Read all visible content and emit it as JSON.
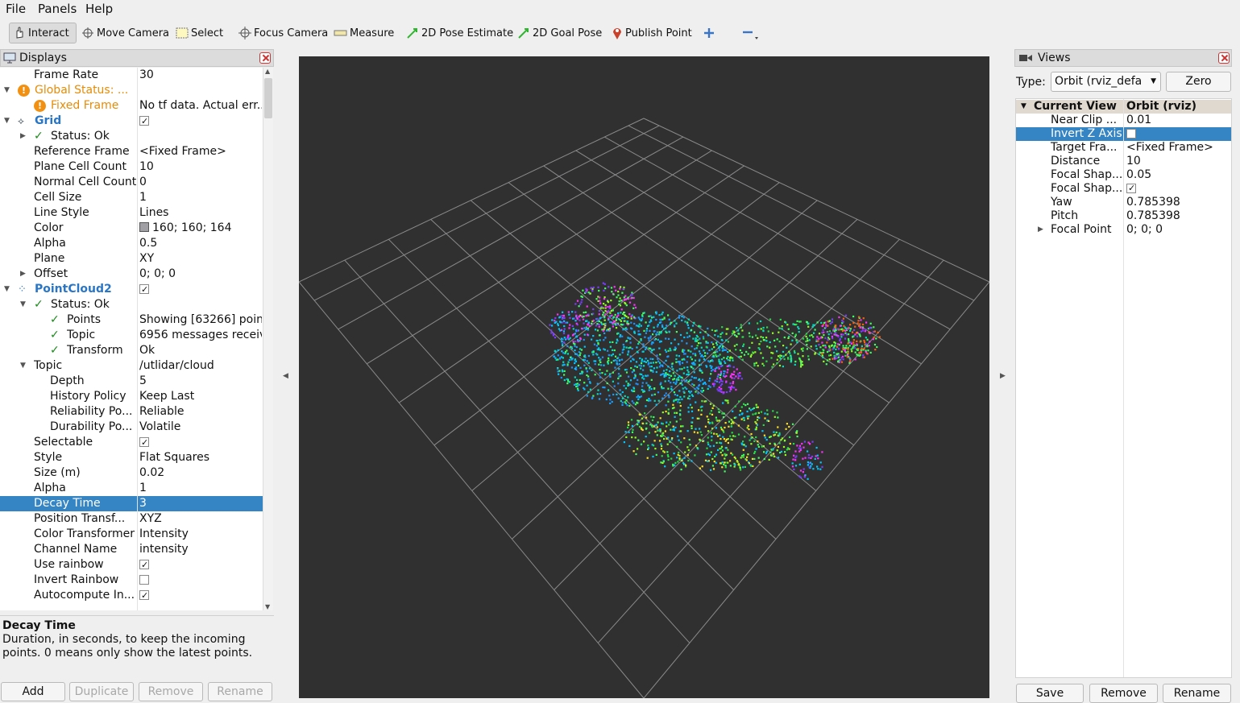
{
  "menu": {
    "file": "File",
    "panels": "Panels",
    "help": "Help"
  },
  "toolbar": {
    "interact": "Interact",
    "move_camera": "Move Camera",
    "select": "Select",
    "focus_camera": "Focus Camera",
    "measure": "Measure",
    "pose_estimate": "2D Pose Estimate",
    "goal_pose": "2D Goal Pose",
    "publish_point": "Publish Point"
  },
  "displays": {
    "title": "Displays",
    "rows": [
      {
        "name": "Frame Rate",
        "value": "30"
      },
      {
        "name": "Global Status: ...",
        "value": ""
      },
      {
        "name": "Fixed Frame",
        "value": "No tf data.  Actual err..."
      },
      {
        "name": "Grid",
        "value": ""
      },
      {
        "name": "Status: Ok",
        "value": ""
      },
      {
        "name": "Reference Frame",
        "value": "<Fixed Frame>"
      },
      {
        "name": "Plane Cell Count",
        "value": "10"
      },
      {
        "name": "Normal Cell Count",
        "value": "0"
      },
      {
        "name": "Cell Size",
        "value": "1"
      },
      {
        "name": "Line Style",
        "value": "Lines"
      },
      {
        "name": "Color",
        "value": "160; 160; 164"
      },
      {
        "name": "Alpha",
        "value": "0.5"
      },
      {
        "name": "Plane",
        "value": "XY"
      },
      {
        "name": "Offset",
        "value": "0; 0; 0"
      },
      {
        "name": "PointCloud2",
        "value": ""
      },
      {
        "name": "Status: Ok",
        "value": ""
      },
      {
        "name": "Points",
        "value": "Showing [63266] poin..."
      },
      {
        "name": "Topic",
        "value": "6956 messages receiv..."
      },
      {
        "name": "Transform",
        "value": "Ok"
      },
      {
        "name": "Topic",
        "value": "/utlidar/cloud"
      },
      {
        "name": "Depth",
        "value": "5"
      },
      {
        "name": "History Policy",
        "value": "Keep Last"
      },
      {
        "name": "Reliability Po...",
        "value": "Reliable"
      },
      {
        "name": "Durability Po...",
        "value": "Volatile"
      },
      {
        "name": "Selectable",
        "value": ""
      },
      {
        "name": "Style",
        "value": "Flat Squares"
      },
      {
        "name": "Size (m)",
        "value": "0.02"
      },
      {
        "name": "Alpha",
        "value": "1"
      },
      {
        "name": "Decay Time",
        "value": "3"
      },
      {
        "name": "Position Transf...",
        "value": "XYZ"
      },
      {
        "name": "Color Transformer",
        "value": "Intensity"
      },
      {
        "name": "Channel Name",
        "value": "intensity"
      },
      {
        "name": "Use rainbow",
        "value": ""
      },
      {
        "name": "Invert Rainbow",
        "value": ""
      },
      {
        "name": "Autocompute In...",
        "value": ""
      }
    ],
    "grid_color": "#a0a0a4",
    "desc_title": "Decay Time",
    "desc_body": "Duration, in seconds, to keep the incoming points. 0 means only show the latest points.",
    "buttons": {
      "add": "Add",
      "duplicate": "Duplicate",
      "remove": "Remove",
      "rename": "Rename"
    }
  },
  "views": {
    "title": "Views",
    "type_label": "Type:",
    "type_value": "Orbit (rviz_default",
    "zero": "Zero",
    "rows": [
      {
        "name": "Current View",
        "value": "Orbit (rviz)"
      },
      {
        "name": "Near Clip ...",
        "value": "0.01"
      },
      {
        "name": "Invert Z Axis",
        "value": ""
      },
      {
        "name": "Target Fra...",
        "value": "<Fixed Frame>"
      },
      {
        "name": "Distance",
        "value": "10"
      },
      {
        "name": "Focal Shap...",
        "value": "0.05"
      },
      {
        "name": "Focal Shap...",
        "value": ""
      },
      {
        "name": "Yaw",
        "value": "0.785398"
      },
      {
        "name": "Pitch",
        "value": "0.785398"
      },
      {
        "name": "Focal Point",
        "value": "0; 0; 0"
      }
    ],
    "buttons": {
      "save": "Save",
      "remove": "Remove",
      "rename": "Rename"
    }
  },
  "colors": {
    "selection": "#3584c4",
    "viewport_bg": "#303030",
    "warning": "#f29111",
    "ok": "#1a8a1a"
  }
}
